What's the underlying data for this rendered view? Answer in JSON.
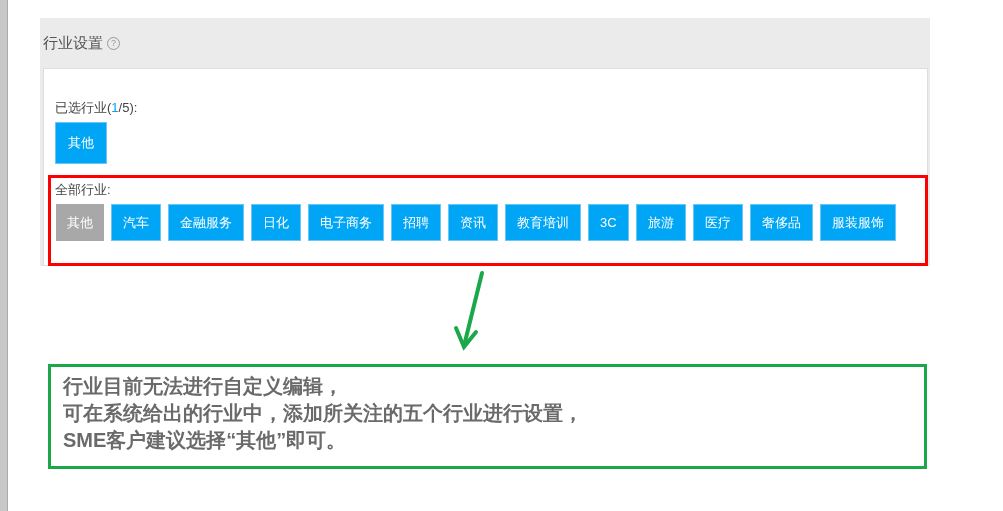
{
  "panel": {
    "title": "行业设置",
    "help_icon": "?"
  },
  "selected_section": {
    "label_prefix": "已选行业(",
    "count": "1",
    "label_suffix": "/5):",
    "items": [
      "其他"
    ]
  },
  "all_section": {
    "label": "全部行业:",
    "items": [
      {
        "label": "其他",
        "selected": true
      },
      {
        "label": "汽车",
        "selected": false
      },
      {
        "label": "金融服务",
        "selected": false
      },
      {
        "label": "日化",
        "selected": false
      },
      {
        "label": "电子商务",
        "selected": false
      },
      {
        "label": "招聘",
        "selected": false
      },
      {
        "label": "资讯",
        "selected": false
      },
      {
        "label": "教育培训",
        "selected": false
      },
      {
        "label": "3C",
        "selected": false
      },
      {
        "label": "旅游",
        "selected": false
      },
      {
        "label": "医疗",
        "selected": false
      },
      {
        "label": "奢侈品",
        "selected": false
      },
      {
        "label": "服装服饰",
        "selected": false
      }
    ]
  },
  "callout": {
    "lines": [
      "行业目前无法进行自定义编辑，",
      "可在系统给出的行业中，添加所关注的五个行业进行设置，",
      "SME客户建议选择“其他”即可。"
    ]
  }
}
